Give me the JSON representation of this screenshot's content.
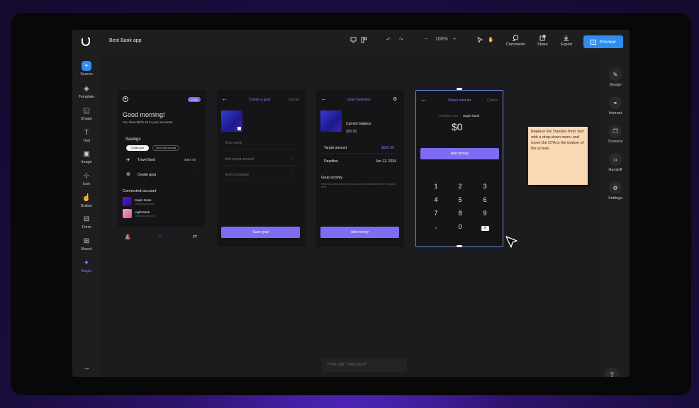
{
  "app": {
    "title": "Best Bank app",
    "zoom": "100%",
    "accent": "#2f8cf0"
  },
  "toolbar": {
    "comments": "Comments",
    "share": "Share",
    "export": "Export",
    "preview": "Preview"
  },
  "left_tools": [
    {
      "label": "Screen",
      "icon": "plus-icon"
    },
    {
      "label": "Template",
      "icon": "layers-icon"
    },
    {
      "label": "Shape",
      "icon": "shape-icon"
    },
    {
      "label": "Text",
      "icon": "text-icon"
    },
    {
      "label": "Image",
      "icon": "image-icon"
    },
    {
      "label": "Icon",
      "icon": "icon-grid-icon"
    },
    {
      "label": "Button",
      "icon": "button-icon"
    },
    {
      "label": "Form",
      "icon": "form-icon"
    },
    {
      "label": "Brand",
      "icon": "brand-icon"
    },
    {
      "label": "Magic",
      "icon": "sparkle-icon"
    }
  ],
  "right_tools": [
    {
      "label": "Design",
      "icon": "pen-icon"
    },
    {
      "label": "Interact",
      "icon": "link-icon"
    },
    {
      "label": "Screens",
      "icon": "screens-icon"
    },
    {
      "label": "Handoff",
      "icon": "code-icon"
    },
    {
      "label": "Settings",
      "icon": "gear-icon"
    }
  ],
  "screen1": {
    "badge": "GOAL",
    "greeting": "Good morning!",
    "sub": "You have $875.32 in your accounts.",
    "savings": "Savings",
    "pill1": "Create goal",
    "pill2": "Upcoming savings",
    "goal1": "Travel fund",
    "goal1_amt": "$487.00",
    "goal2": "Create goal",
    "connected": "Connected account",
    "acc1": "Super Bank",
    "acc1_sub": "Checking account",
    "acc2": "Light Bank",
    "acc2_sub": "Checking account"
  },
  "screen2": {
    "title": "Create a goal",
    "cancel": "Cancel",
    "f1": "Goal name",
    "f2": "Add target amount",
    "f3": "Select deadline",
    "cta": "Save goal"
  },
  "screen3": {
    "title": "Goal Overview",
    "balance_label": "Current balance",
    "balance": "$50.00",
    "target_label": "Target amount",
    "target": "$500.00",
    "deadline_label": "Deadline",
    "deadline": "Jun 12, 2024",
    "activity": "Goal activity",
    "activity_sub": "When you start adding to this goal the transactions will be displayed here.",
    "cta": "Add money"
  },
  "screen4": {
    "title": "Select amount",
    "cancel": "Cancel",
    "transfer": "Transfer from",
    "bank": "Super bank",
    "amount": "$0",
    "cta": "Add money",
    "keys": [
      "1",
      "2",
      "3",
      "4",
      "5",
      "6",
      "7",
      "8",
      "9",
      ",",
      "0"
    ]
  },
  "sticky": "Replace the 'transfer from' text with a drop-down menu and move the CTA to the bottom of the screen.",
  "ask": {
    "placeholder": "How can I help you?"
  },
  "help": "?"
}
